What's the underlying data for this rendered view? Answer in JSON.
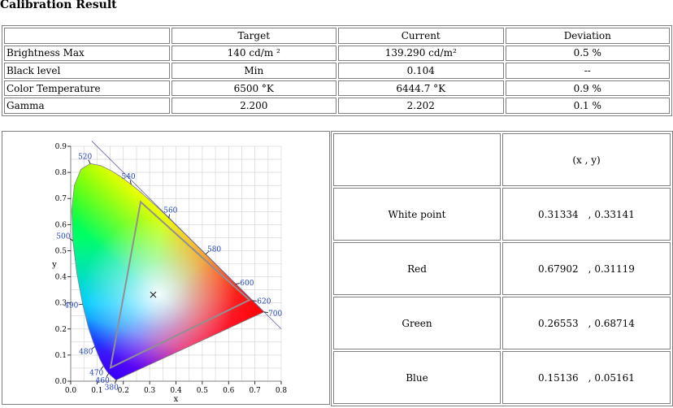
{
  "title": "Calibration Result",
  "results": {
    "headers": [
      "Target",
      "Current",
      "Deviation"
    ],
    "rows": [
      {
        "label": "Brightness Max",
        "target": "140 cd/m ²",
        "current": "139.290 cd/m²",
        "deviation": "0.5 %"
      },
      {
        "label": "Black level",
        "target": "Min",
        "current": "0.104",
        "deviation": "--"
      },
      {
        "label": "Color Temperature",
        "target": "6500 °K",
        "current": "6444.7 °K",
        "deviation": "0.9 %"
      },
      {
        "label": "Gamma",
        "target": "2.200",
        "current": "2.202",
        "deviation": "0.1 %"
      }
    ]
  },
  "points": {
    "header": "(x , y)",
    "rows": [
      {
        "label": "White point",
        "x": "0.31334",
        "y": "0.33141"
      },
      {
        "label": "Red",
        "x": "0.67902",
        "y": "0.31119"
      },
      {
        "label": "Green",
        "x": "0.26553",
        "y": "0.68714"
      },
      {
        "label": "Blue",
        "x": "0.15136",
        "y": "0.05161"
      }
    ]
  },
  "chart_data": {
    "type": "scatter",
    "xlabel": "x",
    "ylabel": "y",
    "xlim": [
      0.0,
      0.8
    ],
    "ylim": [
      0.0,
      0.9
    ],
    "x_ticks": [
      "0.0",
      "0.1",
      "0.2",
      "0.3",
      "0.4",
      "0.5",
      "0.6",
      "0.7",
      "0.8"
    ],
    "y_ticks": [
      "0.0",
      "0.1",
      "0.2",
      "0.3",
      "0.4",
      "0.5",
      "0.6",
      "0.7",
      "0.8",
      "0.9"
    ],
    "grid": true,
    "gamut": [
      [
        0.67902,
        0.31119
      ],
      [
        0.26553,
        0.68714
      ],
      [
        0.15136,
        0.05161
      ]
    ],
    "white_point": [
      0.31334,
      0.33141
    ],
    "wavelength_labels": [
      {
        "label": "380",
        "x": 0.1741,
        "y": 0.005
      },
      {
        "label": "460",
        "x": 0.144,
        "y": 0.0297
      },
      {
        "label": "470",
        "x": 0.1241,
        "y": 0.0578
      },
      {
        "label": "480",
        "x": 0.0913,
        "y": 0.1327
      },
      {
        "label": "490",
        "x": 0.0454,
        "y": 0.295
      },
      {
        "label": "500",
        "x": 0.0082,
        "y": 0.5384
      },
      {
        "label": "520",
        "x": 0.0743,
        "y": 0.8338
      },
      {
        "label": "540",
        "x": 0.2296,
        "y": 0.7543
      },
      {
        "label": "560",
        "x": 0.3731,
        "y": 0.6245
      },
      {
        "label": "580",
        "x": 0.5125,
        "y": 0.4866
      },
      {
        "label": "600",
        "x": 0.627,
        "y": 0.3725
      },
      {
        "label": "620",
        "x": 0.6915,
        "y": 0.3083
      },
      {
        "label": "700",
        "x": 0.7347,
        "y": 0.2653
      }
    ],
    "colors": {
      "gamut_line": "#909090",
      "axis": "#808080",
      "grid": "#d0d0d0",
      "wavelength_text": "#1f3fbf"
    }
  }
}
